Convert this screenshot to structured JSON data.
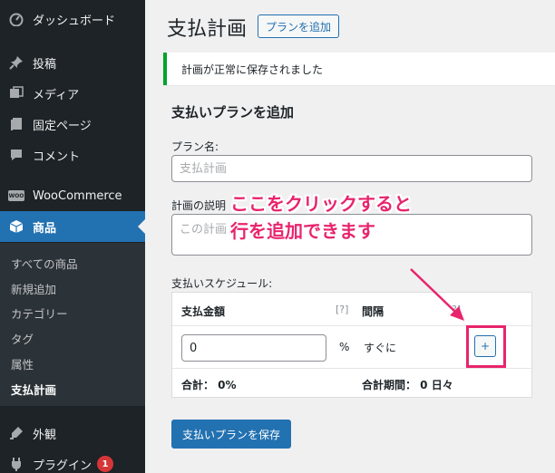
{
  "sidebar": {
    "items": [
      {
        "label": "ダッシュボード",
        "icon": "dashboard-icon"
      },
      {
        "label": "投稿",
        "icon": "pin-icon"
      },
      {
        "label": "メディア",
        "icon": "media-icon"
      },
      {
        "label": "固定ページ",
        "icon": "pages-icon"
      },
      {
        "label": "コメント",
        "icon": "comment-icon"
      },
      {
        "label": "WooCommerce",
        "icon": "woocommerce-icon",
        "icon_text": "WOO"
      },
      {
        "label": "商品",
        "icon": "product-box-icon"
      },
      {
        "label": "外観",
        "icon": "appearance-icon"
      },
      {
        "label": "プラグイン",
        "icon": "plugin-icon",
        "badge": "1"
      }
    ],
    "submenu": [
      "すべての商品",
      "新規追加",
      "カテゴリー",
      "タグ",
      "属性",
      "支払計画"
    ]
  },
  "header": {
    "title": "支払計画",
    "add_button": "プランを追加"
  },
  "notice": "計画が正常に保存されました",
  "form": {
    "section_title": "支払いプランを追加",
    "plan_name_label": "プラン名:",
    "plan_name_placeholder": "支払計画",
    "description_label": "計画の説明",
    "description_placeholder": "この計画",
    "schedule_label": "支払いスケジュール:",
    "schedule": {
      "col_amount": "支払金額",
      "col_interval": "間隔",
      "help": "[?]",
      "help_partial": "?]",
      "amount_value": "0",
      "percent_unit": "%",
      "interval_value": "すぐに",
      "add_row_label": "+",
      "total_label": "合計： 0%",
      "total_period_label": "合計期間： 0 日々"
    },
    "save_button": "支払いプランを保存"
  },
  "annotation": {
    "line1": "ここをクリックすると",
    "line2": "行を追加できます",
    "color": "#e8246c"
  }
}
